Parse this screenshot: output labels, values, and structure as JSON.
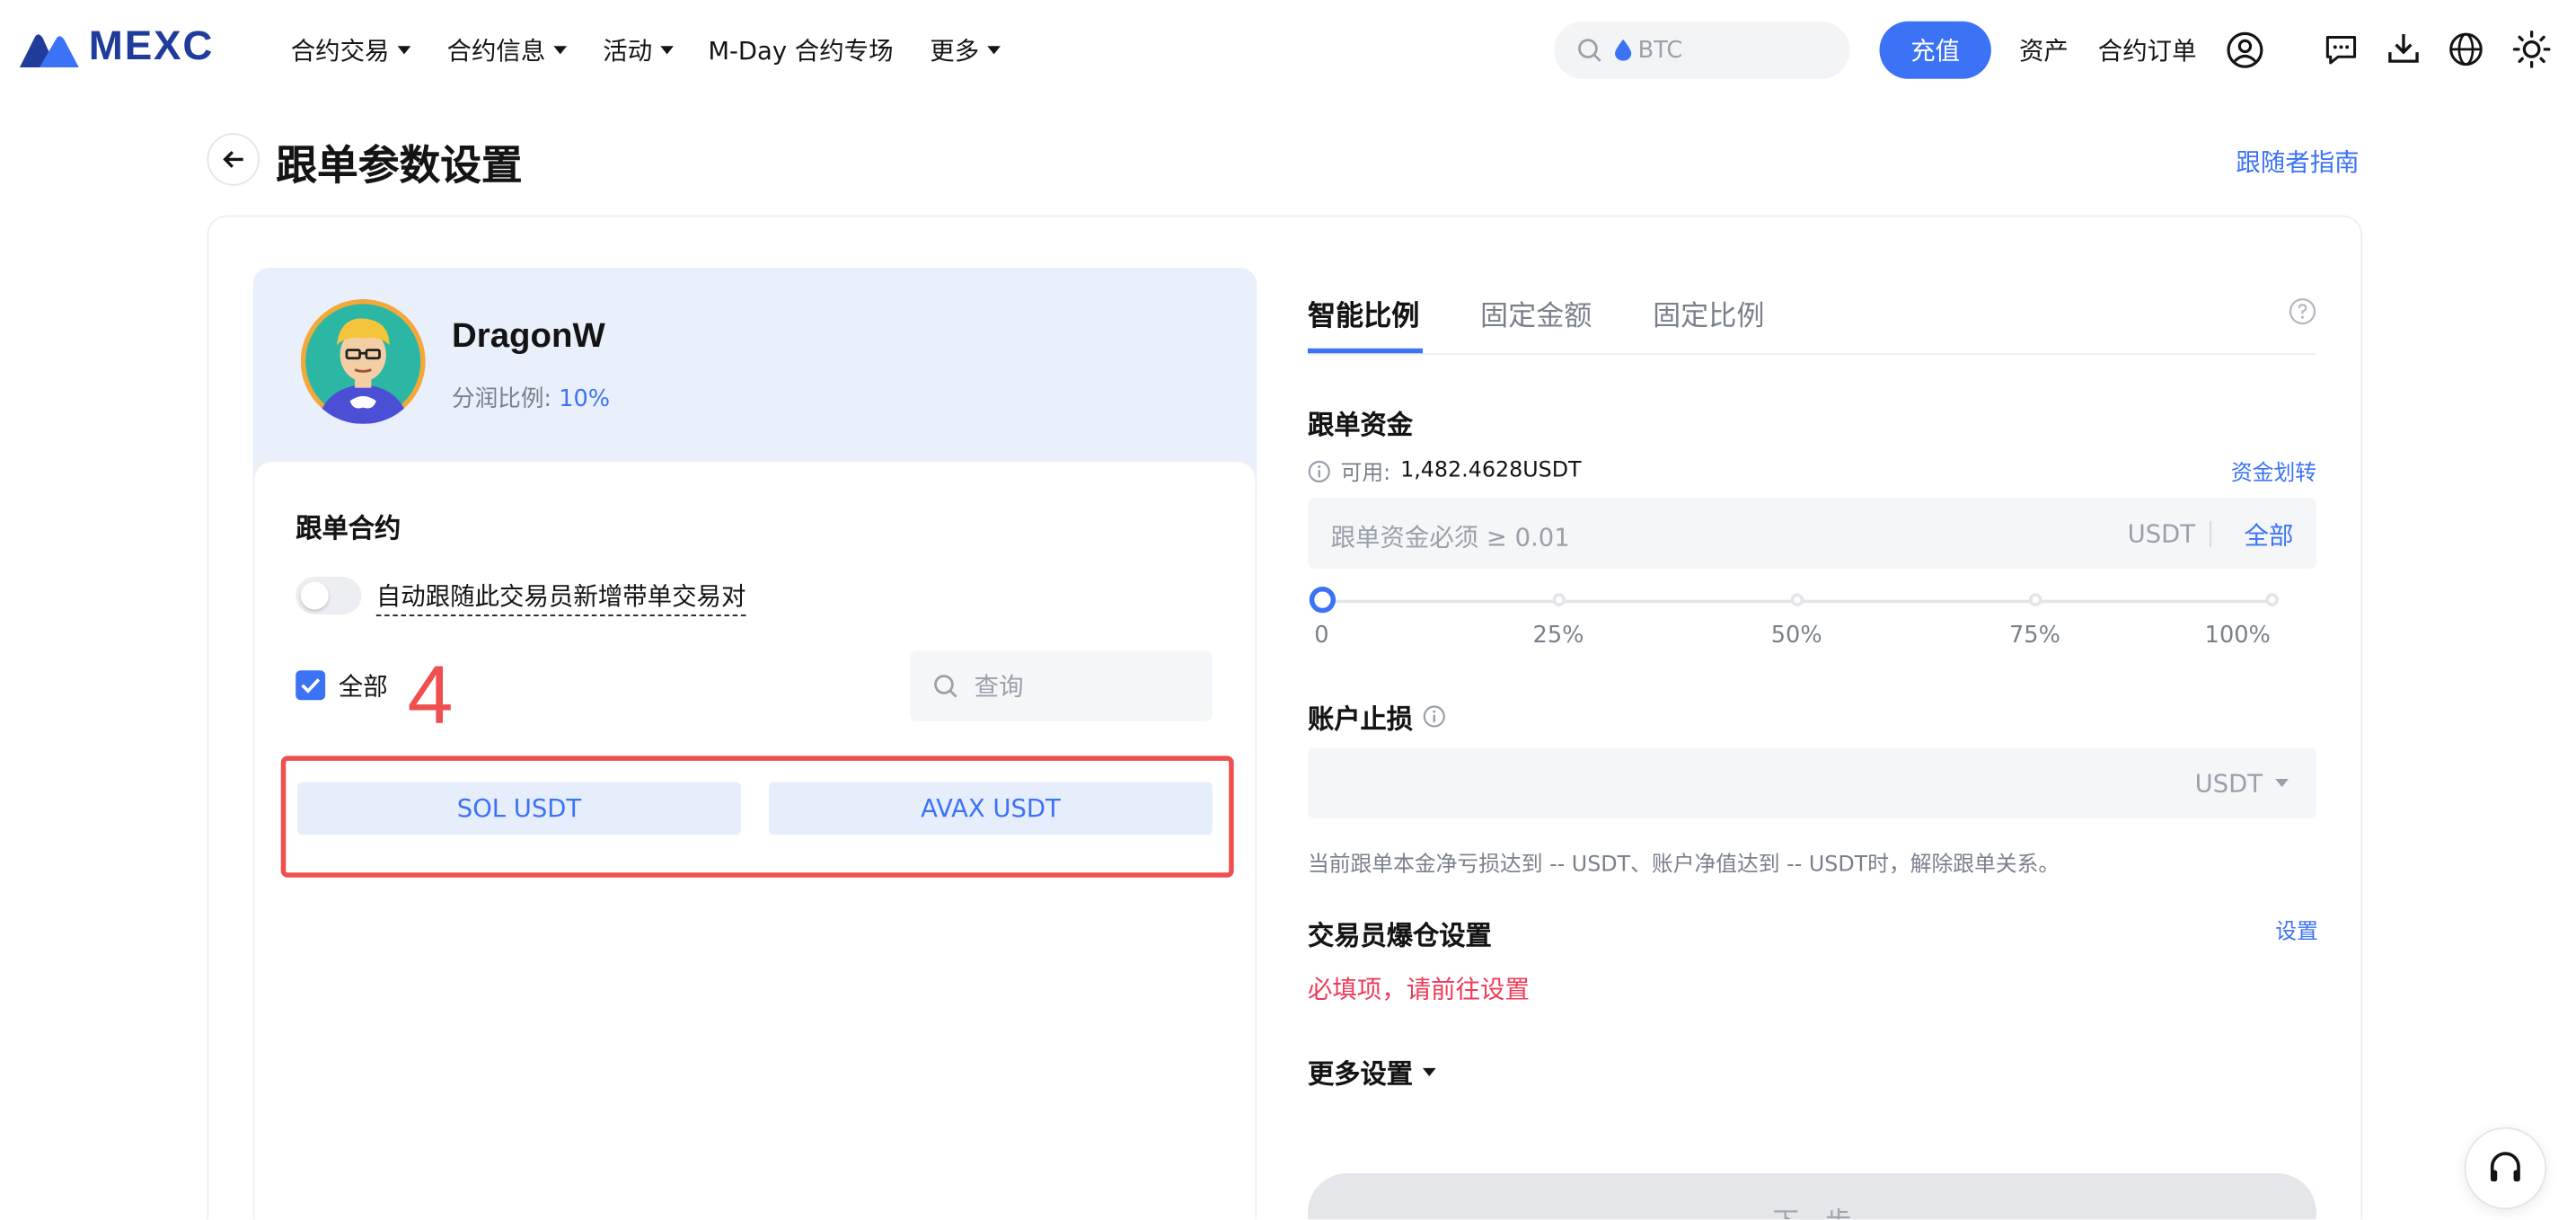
{
  "nav": {
    "logo_text": "MEXC",
    "menu": [
      {
        "label": "合约交易",
        "has_caret": true
      },
      {
        "label": "合约信息",
        "has_caret": true
      },
      {
        "label": "活动",
        "has_caret": true
      },
      {
        "label": "M-Day 合约专场",
        "has_caret": false
      },
      {
        "label": "更多",
        "has_caret": true
      }
    ],
    "search_placeholder": "BTC",
    "deposit_label": "充值",
    "assets_label": "资产",
    "orders_label": "合约订单",
    "icons": [
      "user-icon",
      "message-icon",
      "download-icon",
      "globe-icon",
      "sun-icon"
    ]
  },
  "header": {
    "title": "跟单参数设置",
    "guide_link": "跟随者指南"
  },
  "trader": {
    "name": "DragonW",
    "share_ratio_label": "分润比例:",
    "share_ratio_value": "10%"
  },
  "contracts": {
    "title": "跟单合约",
    "auto_follow_label": "自动跟随此交易员新增带单交易对",
    "auto_follow_on": false,
    "select_all_label": "全部",
    "select_all_checked": true,
    "search_placeholder": "查询",
    "annotation": "4",
    "pairs": [
      "SOL USDT",
      "AVAX USDT"
    ]
  },
  "settings": {
    "tabs": [
      {
        "label": "智能比例",
        "active": true
      },
      {
        "label": "固定金额",
        "active": false
      },
      {
        "label": "固定比例",
        "active": false
      }
    ],
    "fund": {
      "title": "跟单资金",
      "available_label": "可用:",
      "available_value": "1,482.4628USDT",
      "transfer_link": "资金划转",
      "input_placeholder": "跟单资金必须 ≥ 0.01",
      "unit": "USDT",
      "all_label": "全部",
      "slider_labels": [
        "0",
        "25%",
        "50%",
        "75%",
        "100%"
      ],
      "slider_value_percent": 0
    },
    "stop_loss": {
      "title": "账户止损",
      "unit": "USDT",
      "note": "当前跟单本金净亏损达到 -- USDT、账户净值达到 -- USDT时，解除跟单关系。"
    },
    "liquidation": {
      "title": "交易员爆仓设置",
      "set_link": "设置",
      "required_text": "必填项，请前往设置"
    },
    "more_settings_label": "更多设置",
    "next_button": "下一步"
  },
  "colors": {
    "accent": "#3b72f6",
    "brand": "#1f3c9b",
    "danger": "#ef3b5a",
    "annotation": "#ef4f4f"
  }
}
